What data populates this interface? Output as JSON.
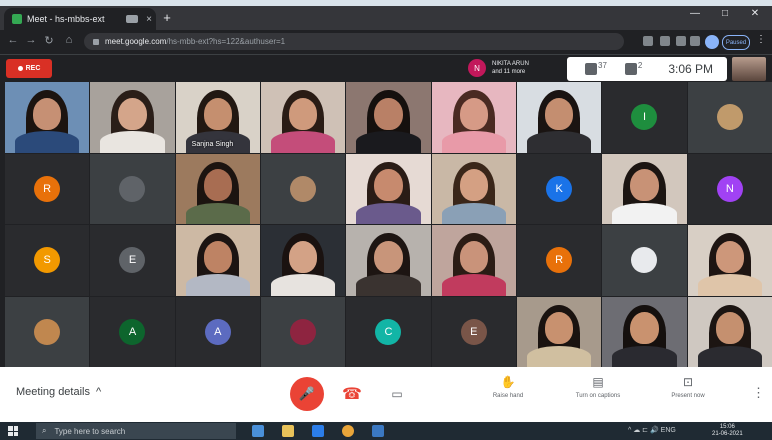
{
  "browser": {
    "tab_title": "Meet - hs-mbbs-ext",
    "url_domain": "meet.google.com",
    "url_path": "/hs-mbb-ext?hs=122&authuser=1",
    "paused_label": "Paused",
    "new_tab": "+",
    "tab_close": "×"
  },
  "meeting": {
    "rec_label": "REC",
    "presenter_initial": "N",
    "presenter_line1": "NIKITA ARUN",
    "presenter_line2": "and 11 more",
    "participants_count": "37",
    "chat_count": "2",
    "time": "3:06 PM",
    "featured_name": "Sanjna Singh"
  },
  "tiles": [
    {
      "kind": "video",
      "bg": "#6d8fb5",
      "skin": "#c69074",
      "hair": "#1c1410",
      "shirt": "#2b4a7a"
    },
    {
      "kind": "video",
      "bg": "#a8a29c",
      "skin": "#d4a58a",
      "hair": "#2a1e18",
      "shirt": "#e9e5e0"
    },
    {
      "kind": "video",
      "bg": "#d9d2c8",
      "skin": "#c58f6f",
      "hair": "#221812",
      "shirt": "#34343c",
      "label": "meeting.featured_name"
    },
    {
      "kind": "video",
      "bg": "#cfc1b6",
      "skin": "#cf9a7c",
      "hair": "#2a1c15",
      "shirt": "#c44d7a"
    },
    {
      "kind": "video",
      "bg": "#8c7770",
      "skin": "#b98066",
      "hair": "#15100e",
      "shirt": "#1a1a1e"
    },
    {
      "kind": "video",
      "bg": "#e7b7c0",
      "skin": "#d69a86",
      "hair": "#4a2a22",
      "shirt": "#e89aa8"
    },
    {
      "kind": "video",
      "bg": "#d8dde2",
      "skin": "#c48e70",
      "hair": "#1a1412",
      "shirt": "#2e2e32"
    },
    {
      "kind": "avatar",
      "initial": "I",
      "color": "#1e8e3e"
    },
    {
      "kind": "photo",
      "color": "#c09a6b"
    },
    {
      "kind": "avatar",
      "initial": "R",
      "color": "#e8710a"
    },
    {
      "kind": "photo",
      "color": "#5f6368"
    },
    {
      "kind": "video",
      "bg": "#9c7a5e",
      "skin": "#a86d52",
      "hair": "#1c1410",
      "shirt": "#5b6b4a"
    },
    {
      "kind": "photo",
      "color": "#b08968"
    },
    {
      "kind": "video",
      "bg": "#e6dad4",
      "skin": "#c78a6e",
      "hair": "#2a1c16",
      "shirt": "#6a5a8c"
    },
    {
      "kind": "video",
      "bg": "#c9b8a6",
      "skin": "#d4a083",
      "hair": "#3a2619",
      "shirt": "#8aa0b6"
    },
    {
      "kind": "avatar",
      "initial": "K",
      "color": "#1a73e8"
    },
    {
      "kind": "video",
      "bg": "#d2c7bd",
      "skin": "#c89276",
      "hair": "#1c1512",
      "shirt": "#f2f2f2"
    },
    {
      "kind": "avatar",
      "initial": "N",
      "color": "#a142f4"
    },
    {
      "kind": "avatar",
      "initial": "S",
      "color": "#f29900"
    },
    {
      "kind": "avatar",
      "initial": "E",
      "color": "#5f6368"
    },
    {
      "kind": "video",
      "bg": "#cdb9a4",
      "skin": "#be8364",
      "hair": "#1c1412",
      "shirt": "#b3b8c4"
    },
    {
      "kind": "video",
      "bg": "#2b2f35",
      "skin": "#d3a286",
      "hair": "#1a1210",
      "shirt": "#e7e3df"
    },
    {
      "kind": "video",
      "bg": "#b7b2ad",
      "skin": "#c8957a",
      "hair": "#1d1512",
      "shirt": "#3a3330"
    },
    {
      "kind": "video",
      "bg": "#bfa59d",
      "skin": "#c9937a",
      "hair": "#2b1c15",
      "shirt": "#c13b5e"
    },
    {
      "kind": "avatar",
      "initial": "R",
      "color": "#e8710a"
    },
    {
      "kind": "photo",
      "color": "#e8eaed"
    },
    {
      "kind": "video",
      "bg": "#d8cfc5",
      "skin": "#cd977a",
      "hair": "#1e1512",
      "shirt": "#dfc5a9"
    },
    {
      "kind": "photo",
      "color": "#c0874f"
    },
    {
      "kind": "avatar",
      "initial": "A",
      "color": "#0d652d"
    },
    {
      "kind": "avatar",
      "initial": "A",
      "color": "#5c6bc0"
    },
    {
      "kind": "photo",
      "color": "#8e2440"
    },
    {
      "kind": "avatar",
      "initial": "C",
      "color": "#12b5a6"
    },
    {
      "kind": "avatar",
      "initial": "E",
      "color": "#795548"
    },
    {
      "kind": "video",
      "bg": "#a79a8c",
      "skin": "#c8916f",
      "hair": "#1a1310",
      "shirt": "#d0bfa0"
    },
    {
      "kind": "video",
      "bg": "#6d6d73",
      "skin": "#c9926f",
      "hair": "#15100e",
      "shirt": "#2a2a30"
    },
    {
      "kind": "video",
      "bg": "#cfc8c1",
      "skin": "#c5906f",
      "hair": "#1c1512",
      "shirt": "#2b2b30"
    }
  ],
  "controls": {
    "meeting_details": "Meeting details",
    "meeting_details_chevron": "^",
    "raise_hand": "Raise hand",
    "captions": "Turn on captions",
    "present": "Present now",
    "more": "⋮"
  },
  "taskbar": {
    "search_placeholder": "Type here to search",
    "tray_text": "^ ☁ ⊏ 🔊 ENG",
    "time": "15:06",
    "date": "21-06-2021"
  },
  "icons": {
    "mic": "mic-off-icon",
    "hangup": "hangup-icon",
    "camera": "camera-icon",
    "hand": "hand-icon",
    "cc": "captions-icon",
    "present": "present-icon"
  }
}
